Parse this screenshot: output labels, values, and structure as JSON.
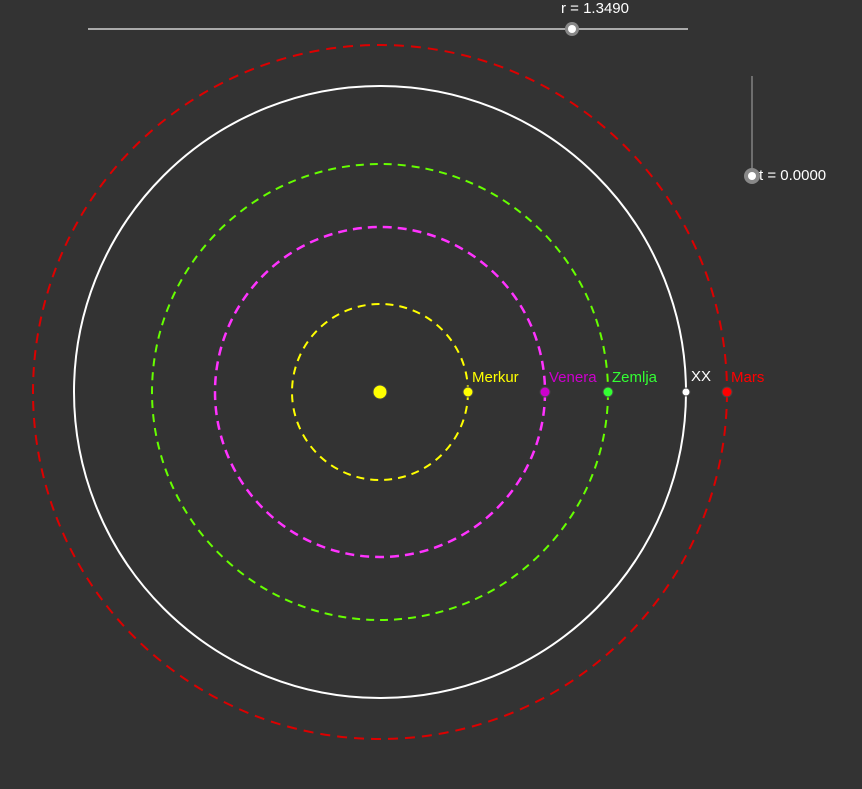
{
  "sliders": {
    "r": {
      "label": "r = 1.3490",
      "value": 1.349,
      "min": 0,
      "max": 1.74
    },
    "t": {
      "label": "t = 0.0000",
      "value": 0.0,
      "min": 0,
      "max": 1
    }
  },
  "sun": {
    "color": "#ffff00"
  },
  "orbits": [
    {
      "name": "Merkur",
      "label": "Merkur",
      "color": "#ffff00",
      "radius_au": 0.387,
      "style": "dashed"
    },
    {
      "name": "Venera",
      "label": "Venera",
      "color": "#cc00cc",
      "orbit_color": "#ff33ff",
      "radius_au": 0.723,
      "style": "dashed"
    },
    {
      "name": "Zemlja",
      "label": "Zemlja",
      "color": "#33ff33",
      "orbit_color": "#66ff00",
      "radius_au": 1.0,
      "style": "dashed"
    },
    {
      "name": "XX",
      "label": "XX",
      "color": "#ffffff",
      "radius_au": 1.349,
      "style": "solid"
    },
    {
      "name": "Mars",
      "label": "Mars",
      "color": "#ff0000",
      "orbit_color": "#dd0000",
      "radius_au": 1.524,
      "style": "dashed"
    }
  ]
}
